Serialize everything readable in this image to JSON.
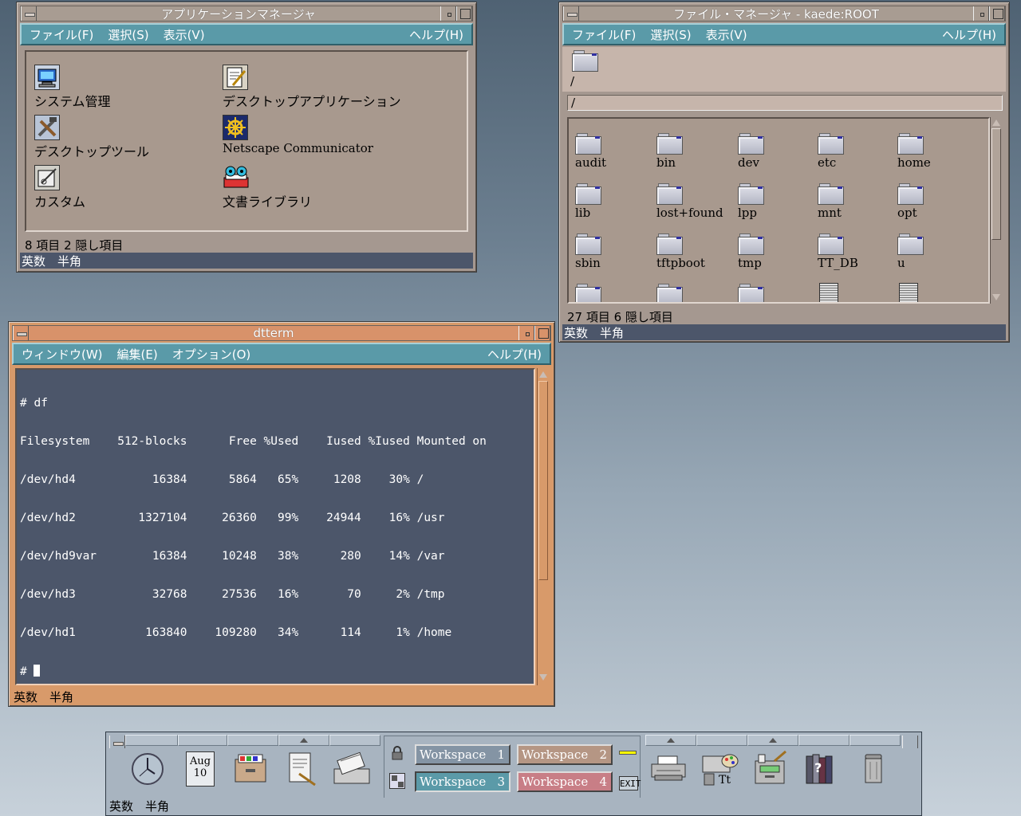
{
  "app_manager": {
    "title": "アプリケーションマネージャ",
    "menu": [
      "ファイル(F)",
      "選択(S)",
      "表示(V)"
    ],
    "help": "ヘルプ(H)",
    "items": [
      {
        "label": "システム管理",
        "icon": "system-admin-icon"
      },
      {
        "label": "デスクトップアプリケーション",
        "icon": "desktop-apps-icon"
      },
      {
        "label": "デスクトップツール",
        "icon": "desktop-tools-icon"
      },
      {
        "label": "Netscape Communicator",
        "icon": "netscape-icon"
      },
      {
        "label": "カスタム",
        "icon": "custom-icon"
      },
      {
        "label": "文書ライブラリ",
        "icon": "document-library-icon"
      }
    ],
    "info": "8 項目 2 隠し項目",
    "ime_status": "英数　半角"
  },
  "file_manager": {
    "title": "ファイル・マネージャ - kaede:ROOT",
    "menu": [
      "ファイル(F)",
      "選択(S)",
      "表示(V)"
    ],
    "help": "ヘルプ(H)",
    "path_label": "/",
    "path_field": "/",
    "items": [
      "audit",
      "bin",
      "dev",
      "etc",
      "home",
      "lib",
      "lost+found",
      "lpp",
      "mnt",
      "opt",
      "sbin",
      "tftpboot",
      "tmp",
      "TT_DB",
      "u"
    ],
    "info": "27 項目 6 隠し項目",
    "ime_status": "英数　半角"
  },
  "dtterm": {
    "title": "dtterm",
    "menu": [
      "ウィンドウ(W)",
      "編集(E)",
      "オプション(O)"
    ],
    "help": "ヘルプ(H)",
    "lines": [
      "# df",
      "Filesystem    512-blocks      Free %Used    Iused %Iused Mounted on",
      "/dev/hd4           16384      5864   65%     1208    30% /",
      "/dev/hd2         1327104     26360   99%    24944    16% /usr",
      "/dev/hd9var        16384     10248   38%      280    14% /var",
      "/dev/hd3           32768     27536   16%       70     2% /tmp",
      "/dev/hd1          163840    109280   34%      114     1% /home"
    ],
    "prompt": "# ",
    "ime_status": "英数　半角"
  },
  "front_panel": {
    "calendar_month": "Aug",
    "calendar_day": "10",
    "workspaces": [
      "Workspace   1",
      "Workspace   2",
      "Workspace   3",
      "Workspace   4"
    ],
    "exit_label": "EXIT",
    "ime_status": "英数　半角"
  },
  "colors": {
    "menubar": "#5a9aa8",
    "status_bar": "#4c566a",
    "active_frame": "#d89a6a",
    "window_bg": "#a59890"
  }
}
